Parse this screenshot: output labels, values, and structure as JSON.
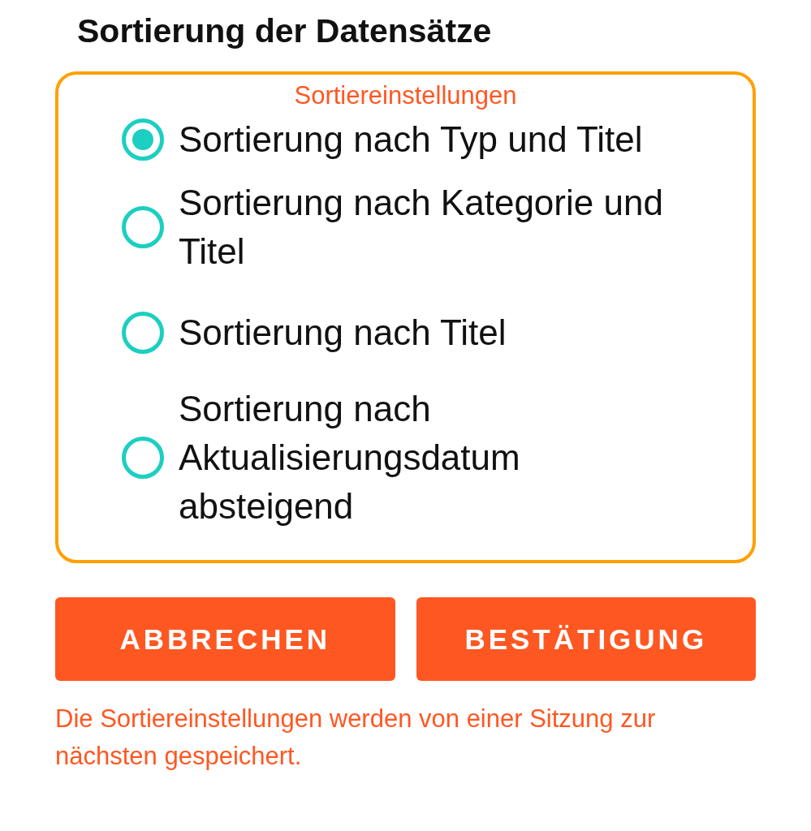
{
  "title": "Sortierung der Datensätze",
  "group": {
    "legend": "Sortiereinstellungen",
    "options": [
      {
        "label": "Sortierung nach Typ und Titel",
        "selected": true
      },
      {
        "label": "Sortierung nach Kategorie und Titel",
        "selected": false
      },
      {
        "label": "Sortierung nach Titel",
        "selected": false
      },
      {
        "label": "Sortierung nach Aktualisierungsdatum absteigend",
        "selected": false
      }
    ]
  },
  "buttons": [
    "ABBRECHEN",
    "BESTÄTIGUNG"
  ],
  "note": "Die Sortiereinstellungen werden von einer Sitzung zur nächsten gespeichert."
}
